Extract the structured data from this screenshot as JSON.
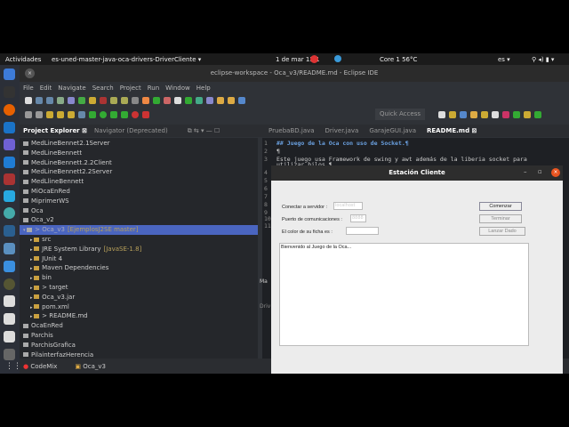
{
  "topbar": {
    "activities": "Actividades",
    "app": "es-uned-master-java-oca-drivers-DriverCliente ▾",
    "clock": "1 de mar 13:1",
    "cpu": "Core 1 56°C",
    "lang": "es ▾"
  },
  "window": {
    "title": "eclipse-workspace - Oca_v3/README.md - Eclipse IDE",
    "close": "×"
  },
  "menu": [
    "File",
    "Edit",
    "Navigate",
    "Search",
    "Project",
    "Run",
    "Window",
    "Help"
  ],
  "quick_access": "Quick Access",
  "left_tabs": [
    "Project Explorer ⊠",
    "Navigator (Deprecated)"
  ],
  "editor_tabs": [
    "PruebaBD.java",
    "Driver.java",
    "GarajeGUI.java",
    "README.md ⊠"
  ],
  "tree": [
    {
      "label": "MedLineBennet2.1Server"
    },
    {
      "label": "MedLineBennett"
    },
    {
      "label": "MedLineBennett.2.2Client"
    },
    {
      "label": "MedLineBennett2.2Server"
    },
    {
      "label": "MedLlineBennett"
    },
    {
      "label": "MiOcaEnRed"
    },
    {
      "label": "MiprimerWS"
    },
    {
      "label": "Oca"
    },
    {
      "label": "Oca_v2"
    },
    {
      "label": "> Oca_v3",
      "suffix": "[EjemplosJ2SE master]",
      "selected": true
    },
    {
      "label": "src",
      "indent": 1
    },
    {
      "label": "JRE System Library",
      "suffix": "[JavaSE-1.8]",
      "indent": 1
    },
    {
      "label": "JUnit 4",
      "indent": 1
    },
    {
      "label": "Maven Dependencies",
      "indent": 1
    },
    {
      "label": "bin",
      "indent": 1
    },
    {
      "label": "> target",
      "indent": 1
    },
    {
      "label": "Oca_v3.jar",
      "indent": 1
    },
    {
      "label": "pom.xml",
      "indent": 1
    },
    {
      "label": "> README.md",
      "indent": 1
    },
    {
      "label": "OcaEnRed"
    },
    {
      "label": "Parchis"
    },
    {
      "label": "ParchisGrafica"
    },
    {
      "label": "PilainterfazHerencia"
    }
  ],
  "taskbar": [
    "CodeMix",
    "Oca_v3"
  ],
  "editor": {
    "lines": [
      {
        "n": "1",
        "text": "## Juego de la Oca con uso de Socket.¶"
      },
      {
        "n": "2",
        "text": "¶"
      },
      {
        "n": "3",
        "text": "Este juego usa Framework de swing y awt además de la liberia socket para"
      },
      {
        "n": "",
        "text": "utilizar hilos.¶"
      },
      {
        "n": "4",
        "text": ""
      },
      {
        "n": "5",
        "text": ""
      },
      {
        "n": "6",
        "text": ""
      },
      {
        "n": "7",
        "text": ""
      },
      {
        "n": "8",
        "text": ""
      },
      {
        "n": "9",
        "text": ""
      },
      {
        "n": "10",
        "text": ""
      },
      {
        "n": "11",
        "text": ""
      }
    ],
    "side_tab": "Ma",
    "side_text": "Driv"
  },
  "dialog": {
    "title": "Estación Cliente",
    "server_label": "Conectar a servidor :",
    "server_value": "localhost",
    "port_label": "Puerto de comunicaciones :",
    "port_value": "8888",
    "color_label": "El color de su ficha es :",
    "color_value": "",
    "start": "Comenzar",
    "stop": "Terminar",
    "roll": "Lanzar Dado",
    "log": "Bienvenido al Juego de la Oca..."
  }
}
